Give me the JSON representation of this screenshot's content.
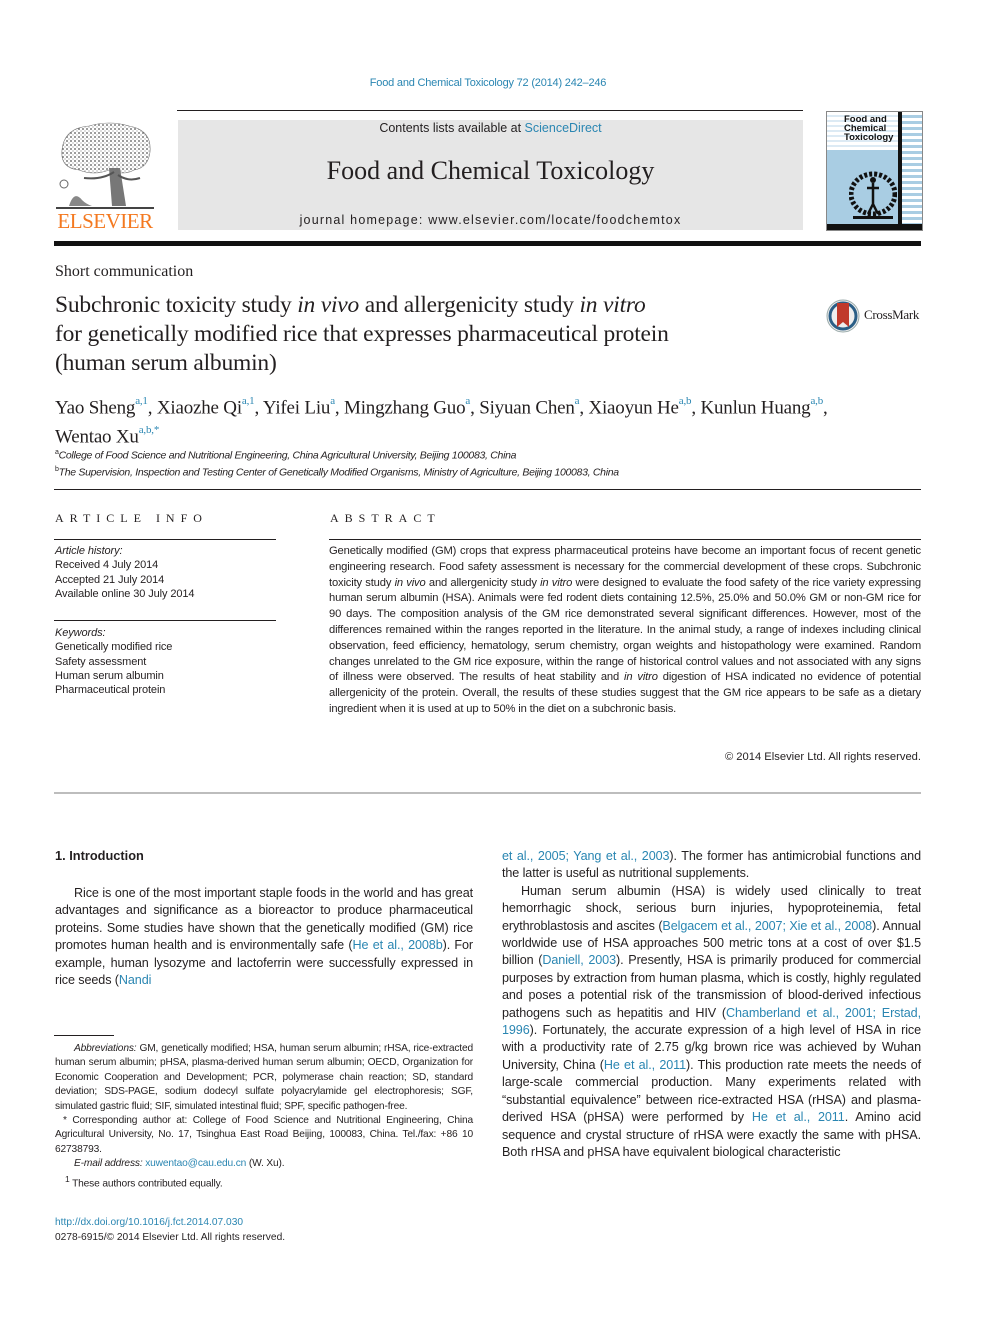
{
  "header": {
    "journal_ref": "Food and Chemical Toxicology 72 (2014) 242–246",
    "contents_prefix": "Contents lists available at ",
    "contents_link": "ScienceDirect",
    "journal_title": "Food and Chemical Toxicology",
    "homepage_prefix": "journal homepage: ",
    "homepage_url": "www.elsevier.com/locate/foodchemtox",
    "publisher_logo": "ELSEVIER",
    "cover_title_lines": [
      "Food and",
      "Chemical",
      "Toxicology"
    ],
    "crossmark_label": "CrossMark"
  },
  "colors": {
    "link": "#2a86b2",
    "elsevier_orange": "#f47920",
    "banner_gray": "#e6e6e6",
    "cover_blue": "#a9cde3",
    "crossmark_red": "#c0392b"
  },
  "article": {
    "type": "Short communication",
    "title_parts": [
      {
        "text": "Subchronic toxicity study ",
        "italic": false
      },
      {
        "text": "in vivo",
        "italic": true
      },
      {
        "text": " and allergenicity study ",
        "italic": false
      },
      {
        "text": "in vitro",
        "italic": true
      },
      {
        "text": "\nfor genetically modified rice that expresses pharmaceutical protein\n(human serum albumin)",
        "italic": false
      }
    ],
    "authors": [
      {
        "name": "Yao Sheng",
        "sup": "a,1"
      },
      {
        "name": "Xiaozhe Qi",
        "sup": "a,1"
      },
      {
        "name": "Yifei Liu",
        "sup": "a"
      },
      {
        "name": "Mingzhang Guo",
        "sup": "a"
      },
      {
        "name": "Siyuan Chen",
        "sup": "a"
      },
      {
        "name": "Xiaoyun He",
        "sup": "a,b"
      },
      {
        "name": "Kunlun Huang",
        "sup": "a,b"
      },
      {
        "name": "Wentao Xu",
        "sup": "a,b,*"
      }
    ],
    "affiliations": [
      {
        "key": "a",
        "text": "College of Food Science and Nutritional Engineering, China Agricultural University, Beijing 100083, China"
      },
      {
        "key": "b",
        "text": "The Supervision, Inspection and Testing Center of Genetically Modified Organisms, Ministry of Agriculture, Beijing 100083, China"
      }
    ]
  },
  "article_info": {
    "heading": "ARTICLE INFO",
    "history_label": "Article history:",
    "history": [
      "Received 4 July 2014",
      "Accepted 21 July 2014",
      "Available online 30 July 2014"
    ],
    "keywords_label": "Keywords:",
    "keywords": [
      "Genetically modified rice",
      "Safety assessment",
      "Human serum albumin",
      "Pharmaceutical protein"
    ]
  },
  "abstract": {
    "heading": "ABSTRACT",
    "parts": [
      {
        "text": "Genetically modified (GM) crops that express pharmaceutical proteins have become an important focus of recent genetic engineering research. Food safety assessment is necessary for the commercial development of these crops. Subchronic toxicity study ",
        "italic": false
      },
      {
        "text": "in vivo",
        "italic": true
      },
      {
        "text": " and allergenicity study ",
        "italic": false
      },
      {
        "text": "in vitro",
        "italic": true
      },
      {
        "text": " were designed to evaluate the food safety of the rice variety expressing human serum albumin (HSA). Animals were fed rodent diets containing 12.5%, 25.0% and 50.0% GM or non-GM rice for 90 days. The composition analysis of the GM rice demonstrated several significant differences. However, most of the differences remained within the ranges reported in the literature. In the animal study, a range of indexes including clinical observation, feed efficiency, hematology, serum chemistry, organ weights and histopathology were examined. Random changes unrelated to the GM rice exposure, within the range of historical control values and not associated with any signs of illness were observed. The results of heat stability and ",
        "italic": false
      },
      {
        "text": "in vitro",
        "italic": true
      },
      {
        "text": " digestion of HSA indicated no evidence of potential allergenicity of the protein. Overall, the results of these studies suggest that the GM rice appears to be safe as a dietary ingredient when it is used at up to 50% in the diet on a subchronic basis.",
        "italic": false
      }
    ],
    "copyright": "© 2014 Elsevier Ltd. All rights reserved."
  },
  "body": {
    "section_heading": "1. Introduction",
    "left_column": [
      {
        "text": "Rice is one of the most important staple foods in the world and has great advantages and significance as a bioreactor to produce pharmaceutical proteins. Some studies have shown that the genetically modified (GM) rice promotes human health and is environmentally safe (",
        "link": false
      },
      {
        "text": "He et al., 2008b",
        "link": true
      },
      {
        "text": "). For example, human lysozyme and lactoferrin were successfully expressed in rice seeds (",
        "link": false
      },
      {
        "text": "Nandi",
        "link": true
      }
    ],
    "right_column_p1": [
      {
        "text": "et al., 2005; Yang et al., 2003",
        "link": true
      },
      {
        "text": "). The former has antimicrobial functions and the latter is useful as nutritional supplements.",
        "link": false
      }
    ],
    "right_column_p2": [
      {
        "text": "Human serum albumin (HSA) is widely used clinically to treat hemorrhagic shock, serious burn injuries, hypoproteinemia, fetal erythroblastosis and ascites (",
        "link": false
      },
      {
        "text": "Belgacem et al., 2007; Xie et al., 2008",
        "link": true
      },
      {
        "text": "). Annual worldwide use of HSA approaches 500 metric tons at a cost of over $1.5 billion (",
        "link": false
      },
      {
        "text": "Daniell, 2003",
        "link": true
      },
      {
        "text": "). Presently, HSA is primarily produced for commercial purposes by extraction from human plasma, which is costly, highly regulated and poses a potential risk of the transmission of blood-derived infectious pathogens such as hepatitis and HIV (",
        "link": false
      },
      {
        "text": "Chamberland et al., 2001; Erstad, 1996",
        "link": true
      },
      {
        "text": "). Fortunately, the accurate expression of a high level of HSA in rice with a productivity rate of 2.75 g/kg brown rice was achieved by Wuhan University, China (",
        "link": false
      },
      {
        "text": "He et al., 2011",
        "link": true
      },
      {
        "text": "). This production rate meets the needs of large-scale commercial production. Many experiments related with “substantial equivalence” between rice-extracted HSA (rHSA) and plasma-derived HSA (pHSA) were performed by ",
        "link": false
      },
      {
        "text": "He et al., 2011",
        "link": true
      },
      {
        "text": ". Amino acid sequence and crystal structure of rHSA were exactly the same with pHSA. Both rHSA and pHSA have equivalent biological characteristic",
        "link": false
      }
    ]
  },
  "footnotes": {
    "abbreviations_label": "Abbreviations:",
    "abbreviations": " GM, genetically modified; HSA, human serum albumin; rHSA, rice-extracted human serum albumin; pHSA, plasma-derived human serum albumin; OECD, Organization for Economic Cooperation and Development; PCR, polymerase chain reaction; SD, standard deviation; SDS-PAGE, sodium dodecyl sulfate polyacrylamide gel electrophoresis; SGF, simulated gastric fluid; SIF, simulated intestinal fluid; SPF, specific pathogen-free.",
    "corresponding": "* Corresponding author at: College of Food Science and Nutritional Engineering, China Agricultural University, No. 17, Tsinghua East Road Beijing, 100083, China. Tel./fax: +86 10 62738793.",
    "email_label": "E-mail address:",
    "email": "xuwentao@cau.edu.cn",
    "email_suffix": " (W. Xu).",
    "equal_contrib_mark": "1",
    "equal_contrib": "These authors contributed equally.",
    "doi": "http://dx.doi.org/10.1016/j.fct.2014.07.030",
    "issn_line": "0278-6915/© 2014 Elsevier Ltd. All rights reserved."
  }
}
